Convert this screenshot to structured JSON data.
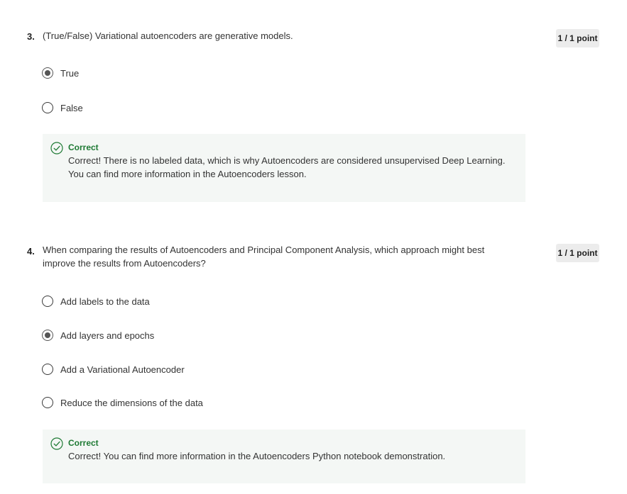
{
  "questions": [
    {
      "number": "3.",
      "text": "(True/False) Variational autoencoders are generative models.",
      "points": "1 / 1 point",
      "options": [
        {
          "label": "True",
          "selected": true
        },
        {
          "label": "False",
          "selected": false
        }
      ],
      "feedback": {
        "title": "Correct",
        "body": "Correct! There is no labeled data, which is why Autoencoders are considered unsupervised Deep Learning. You can find more information in the Autoencoders lesson."
      }
    },
    {
      "number": "4.",
      "text": "When comparing the results of Autoencoders and Principal Component Analysis, which approach might best improve the results from Autoencoders?",
      "points": "1 / 1 point",
      "options": [
        {
          "label": "Add labels to the data",
          "selected": false
        },
        {
          "label": "Add layers and epochs",
          "selected": true
        },
        {
          "label": "Add a Variational Autoencoder",
          "selected": false
        },
        {
          "label": "Reduce the dimensions of the data",
          "selected": false
        }
      ],
      "feedback": {
        "title": "Correct",
        "body": "Correct! You can find more information in the Autoencoders Python notebook demonstration."
      }
    }
  ],
  "colors": {
    "correct_green": "#1e7a34",
    "feedback_bg": "#f4f7f5",
    "badge_bg": "#ececec"
  },
  "icons": {
    "feedback": "check-circle-icon",
    "radio": "radio-button-icon"
  }
}
